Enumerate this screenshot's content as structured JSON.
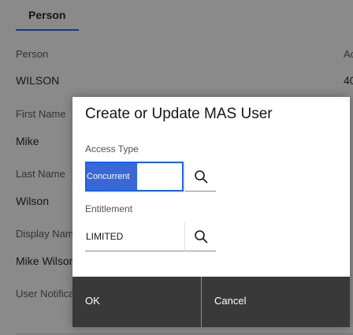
{
  "background": {
    "tab_label": "Person",
    "fields": [
      {
        "label": "Person",
        "value": "WILSON"
      },
      {
        "label": "First Name",
        "value": "Mike"
      },
      {
        "label": "Last Name",
        "value": "Wilson"
      },
      {
        "label": "Display Name",
        "value": "Mike Wilson"
      },
      {
        "label": "User Notifications",
        "value": ""
      }
    ],
    "right_col_label": "Ac",
    "right_col_value": "40"
  },
  "modal": {
    "title": "Create or Update MAS User",
    "access_type_label": "Access Type",
    "access_type_value": "Concurrent",
    "entitlement_label": "Entitlement",
    "entitlement_value": "LIMITED",
    "ok_label": "OK",
    "cancel_label": "Cancel"
  },
  "icons": {
    "lookup": "search-icon"
  },
  "colors": {
    "accent": "#0f62fe",
    "selection": "#3a67d6",
    "footer_button": "#393939"
  }
}
